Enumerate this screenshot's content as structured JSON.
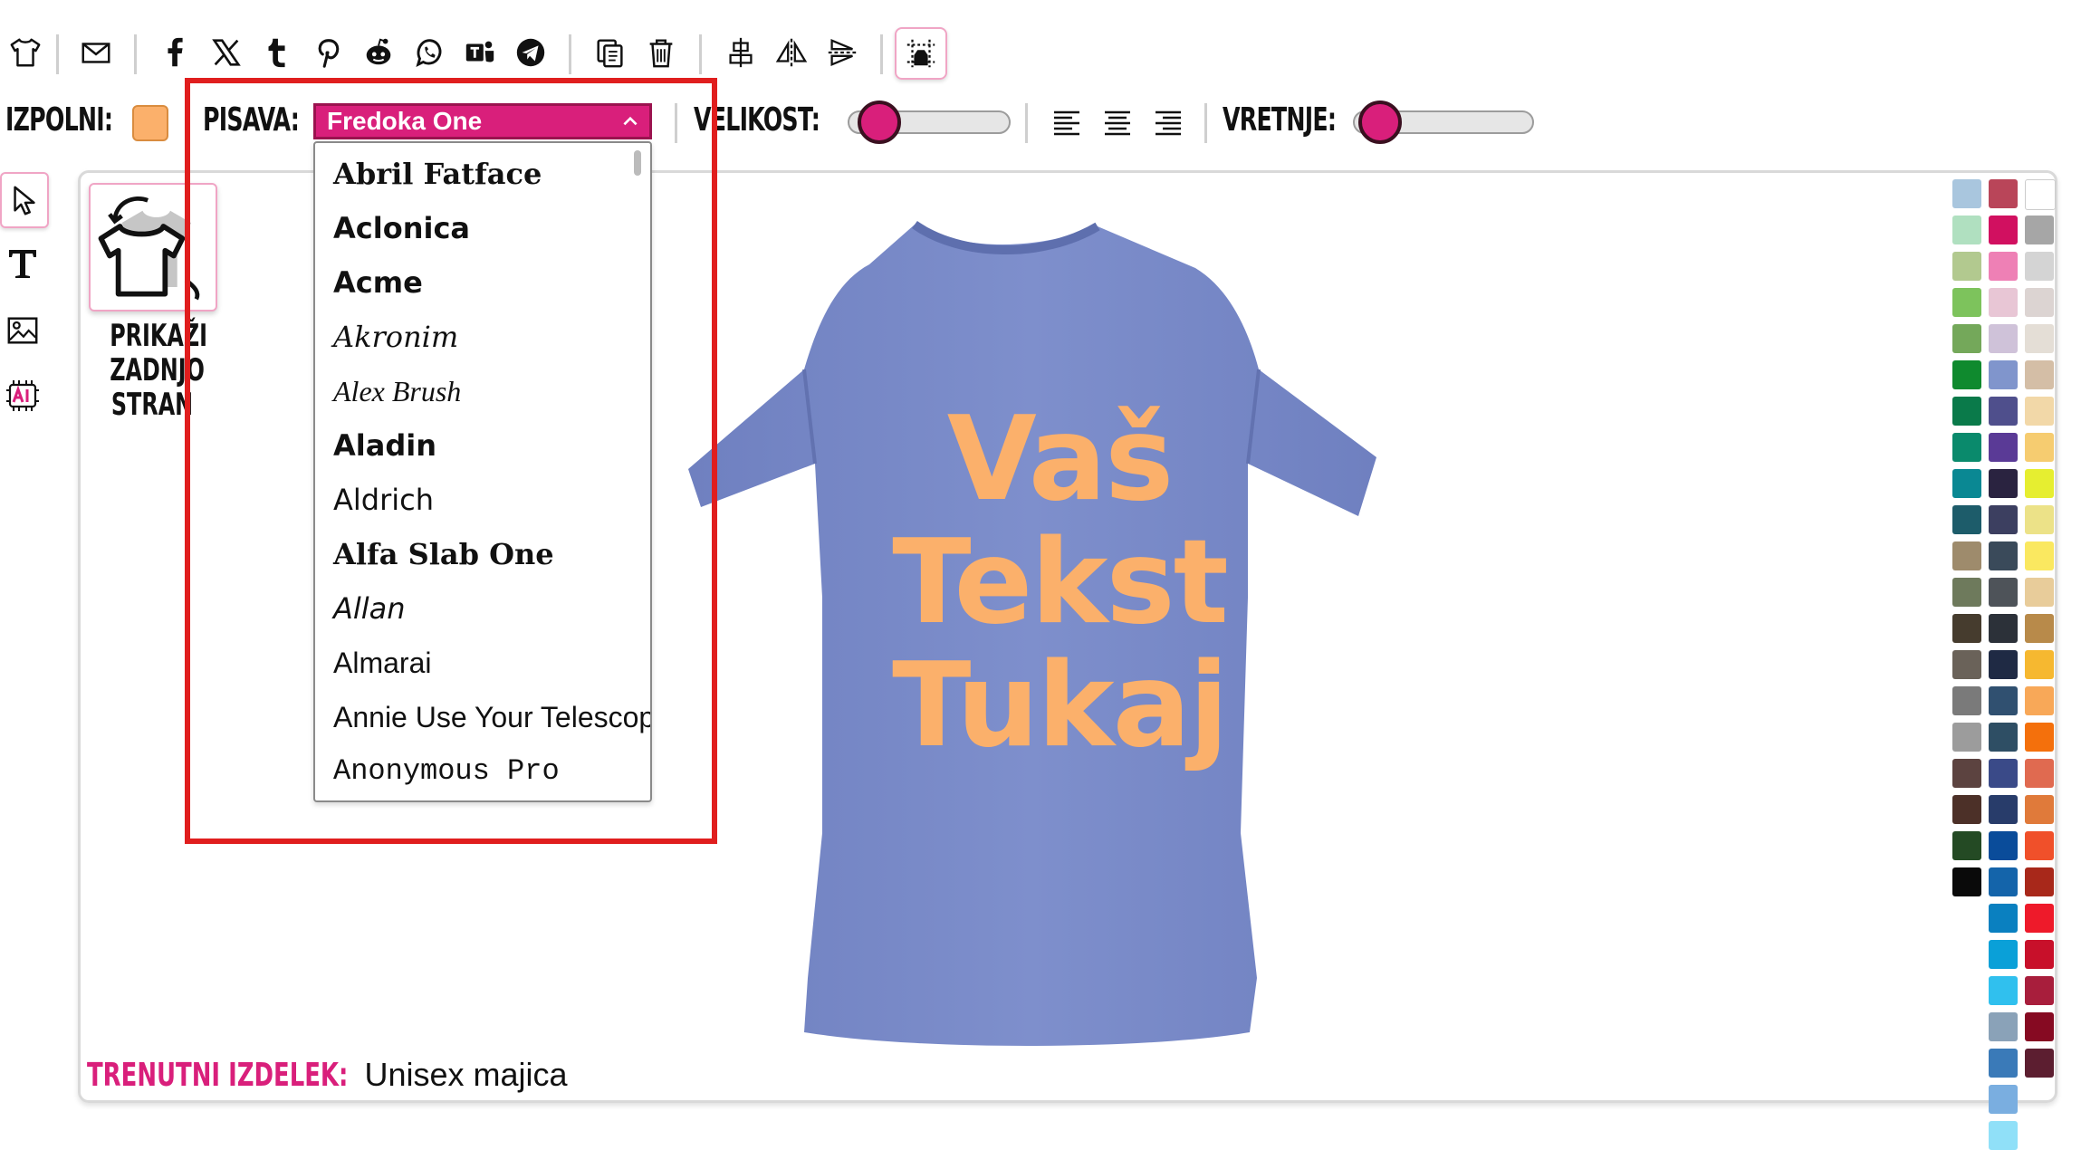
{
  "toolbar": {
    "icons": [
      "tshirt-icon",
      "mail-icon",
      "facebook-icon",
      "x-icon",
      "tumblr-icon",
      "pinterest-icon",
      "reddit-icon",
      "whatsapp-icon",
      "teams-icon",
      "telegram-icon",
      "copy-icon",
      "trash-icon",
      "align-center-icon",
      "flip-horizontal-icon",
      "flip-vertical-icon",
      "grid-icon"
    ]
  },
  "controls": {
    "fill_label": "IZPOLNI:",
    "fill_color": "#fbb06b",
    "font_label": "PISAVA:",
    "font_selected": "Fredoka One",
    "size_label": "VELIKOST:",
    "size_level": 0.1,
    "rotate_label": "VRETNJE:",
    "rotate_level": 0.05
  },
  "font_options": [
    {
      "name": "Abril Fatface",
      "family": "\"DejaVu Serif\", serif",
      "weight": "bold",
      "style": "normal"
    },
    {
      "name": "Aclonica",
      "family": "\"DejaVu Sans\", sans-serif",
      "weight": "bold",
      "style": "normal"
    },
    {
      "name": "Acme",
      "family": "\"DejaVu Sans\", sans-serif",
      "weight": "bold",
      "style": "normal"
    },
    {
      "name": "Akronim",
      "family": "\"DejaVu Serif\", serif",
      "weight": "normal",
      "style": "italic"
    },
    {
      "name": "Alex Brush",
      "family": "\"Liberation Serif\", serif",
      "weight": "normal",
      "style": "italic"
    },
    {
      "name": "Aladin",
      "family": "\"DejaVu Sans\", sans-serif",
      "weight": "bold",
      "style": "normal"
    },
    {
      "name": "Aldrich",
      "family": "\"DejaVu Sans\", sans-serif",
      "weight": "normal",
      "style": "normal"
    },
    {
      "name": "Alfa Slab One",
      "family": "\"DejaVu Serif\", serif",
      "weight": "bold",
      "style": "normal"
    },
    {
      "name": "Allan",
      "family": "\"DejaVu Sans\", sans-serif",
      "weight": "normal",
      "style": "italic"
    },
    {
      "name": "Almarai",
      "family": "\"Liberation Sans\", sans-serif",
      "weight": "normal",
      "style": "normal"
    },
    {
      "name": "Annie Use Your Telescope",
      "family": "\"Liberation Sans\", sans-serif",
      "weight": "normal",
      "style": "normal"
    },
    {
      "name": "Anonymous Pro",
      "family": "\"Liberation Mono\", monospace",
      "weight": "normal",
      "style": "normal"
    }
  ],
  "tools": [
    "select-tool",
    "text-tool",
    "image-tool",
    "ai-tool"
  ],
  "back_side": {
    "label_line1": "PRIKAŽI",
    "label_line2": "ZADNJO",
    "label_line3": "STRAN"
  },
  "design": {
    "shirt_color": "#7b8cc8",
    "text_line1": "Vaš",
    "text_line2": "Tekst",
    "text_line3": "Tukaj"
  },
  "status": {
    "label": "TRENUTNI IZDELEK:",
    "value": " Unisex majica"
  },
  "palette": {
    "col1": [
      "#a9c6de",
      "#b0e0c0",
      "#b2c98f",
      "#7dc35c",
      "#74a85a",
      "#0f8a2e",
      "#0a7a4a",
      "#0a8a6c",
      "#0a8893",
      "#1d5c6a",
      "#9e8b6c",
      "#6e7a5c",
      "#463c2e",
      "#6a6259",
      "#7a7a7a",
      "#9c9c9c",
      "#5c4340",
      "#4c3028",
      "#244a24",
      "#0a0a0a"
    ],
    "col2": [
      "#b94559",
      "#d11060",
      "#ee80b5",
      "#e8c6d5",
      "#cfc2d9",
      "#8095cc",
      "#4f4f8c",
      "#5a3a96",
      "#2a2340",
      "#3c3f60",
      "#3a4a5a",
      "#4e5359",
      "#2c3139",
      "#1f2a44",
      "#305070",
      "#2e4e64",
      "#3a4a88",
      "#283c6a",
      "#0a4c9a",
      "#1464aa",
      "#0a80c0",
      "#0aa0d8",
      "#30c0ee",
      "#8aa2b8",
      "#3a7ab8",
      "#7aaee0",
      "#90e0f8"
    ],
    "col3": [
      "#ffffff",
      "#a6a6a6",
      "#d4d4d4",
      "#dcd4d2",
      "#e4ded6",
      "#d4bea6",
      "#f2d8a8",
      "#f6cc70",
      "#e6ee30",
      "#ece288",
      "#fae860",
      "#e8cc9a",
      "#b88a4a",
      "#f6b830",
      "#f8a858",
      "#f4700c",
      "#e06a50",
      "#e07a3a",
      "#f0502a",
      "#a8281a",
      "#ee1a2a",
      "#c8102a",
      "#a81e3c",
      "#860a22",
      "#5c1e30"
    ]
  }
}
